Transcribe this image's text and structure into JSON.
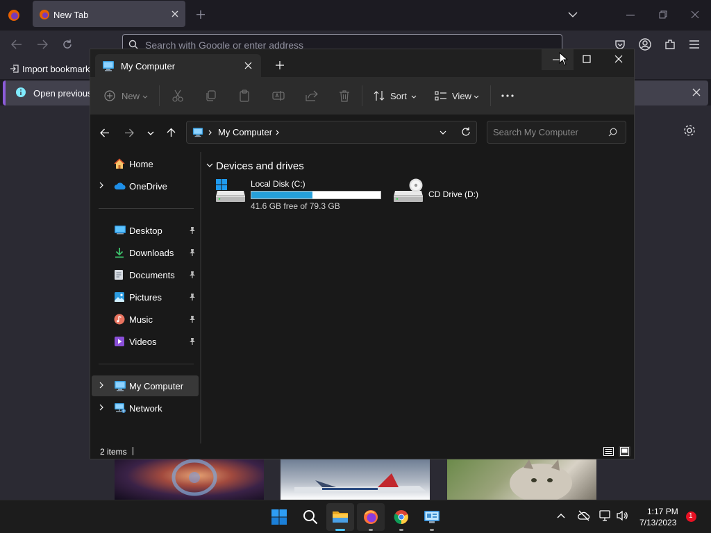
{
  "firefox": {
    "tab_title": "New Tab",
    "urlbar_placeholder": "Search with Google or enter address",
    "import_bookmarks": "Import bookmarks",
    "notification_text": "Open previous ta"
  },
  "explorer": {
    "tab_title": "My Computer",
    "toolbar": {
      "new_label": "New",
      "sort_label": "Sort",
      "view_label": "View"
    },
    "address": {
      "breadcrumb": "My Computer",
      "search_placeholder": "Search My Computer"
    },
    "nav": {
      "home": "Home",
      "onedrive": "OneDrive",
      "desktop": "Desktop",
      "downloads": "Downloads",
      "documents": "Documents",
      "pictures": "Pictures",
      "music": "Music",
      "videos": "Videos",
      "my_computer": "My Computer",
      "network": "Network"
    },
    "main": {
      "group_title": "Devices and drives",
      "drives": [
        {
          "name": "Local Disk (C:)",
          "free_text": "41.6 GB free of 79.3 GB",
          "used_fraction": 0.475
        },
        {
          "name": "CD Drive (D:)"
        }
      ]
    },
    "status": {
      "item_count": "2 items"
    }
  },
  "taskbar": {
    "time": "1:17 PM",
    "date": "7/13/2023",
    "notification_count": "1"
  },
  "colors": {
    "accent": "#4cc2ff",
    "drive_bar_fill": "#26a0da",
    "notification_badge": "#e81123"
  }
}
